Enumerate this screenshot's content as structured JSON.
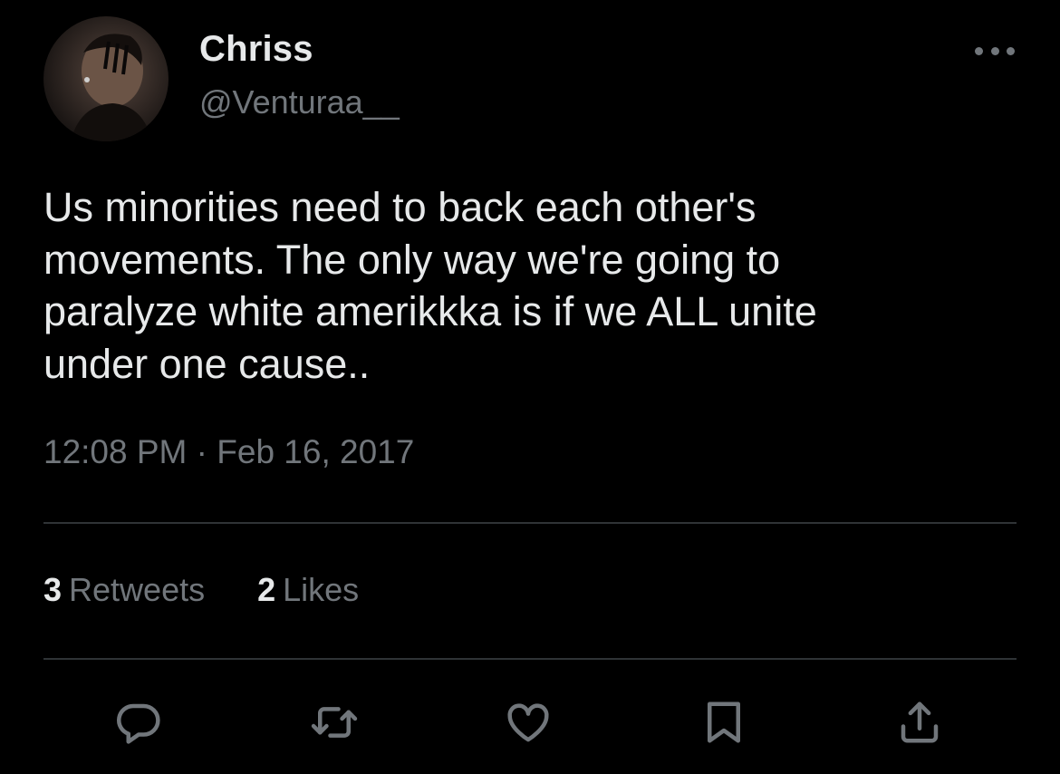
{
  "author": {
    "display_name": "Chriss",
    "handle": "@Venturaa__",
    "avatar_icon": "profile-photo"
  },
  "tweet": {
    "text": "Us minorities need to back each other's\nmovements. The only way we're going to\nparalyze white amerikkka is if we ALL unite\nunder one cause..",
    "time": "12:08 PM",
    "separator": "·",
    "date": "Feb 16, 2017"
  },
  "stats": {
    "retweets_count": "3",
    "retweets_label": "Retweets",
    "likes_count": "2",
    "likes_label": "Likes"
  },
  "actions": [
    {
      "icon": "reply-icon"
    },
    {
      "icon": "retweet-icon"
    },
    {
      "icon": "like-icon"
    },
    {
      "icon": "bookmark-icon"
    },
    {
      "icon": "share-icon"
    }
  ],
  "more_icon": "more-options-icon",
  "colors": {
    "background": "#000000",
    "primary_text": "#e7e9ea",
    "secondary_text": "#71767b",
    "divider": "#2f3336"
  }
}
